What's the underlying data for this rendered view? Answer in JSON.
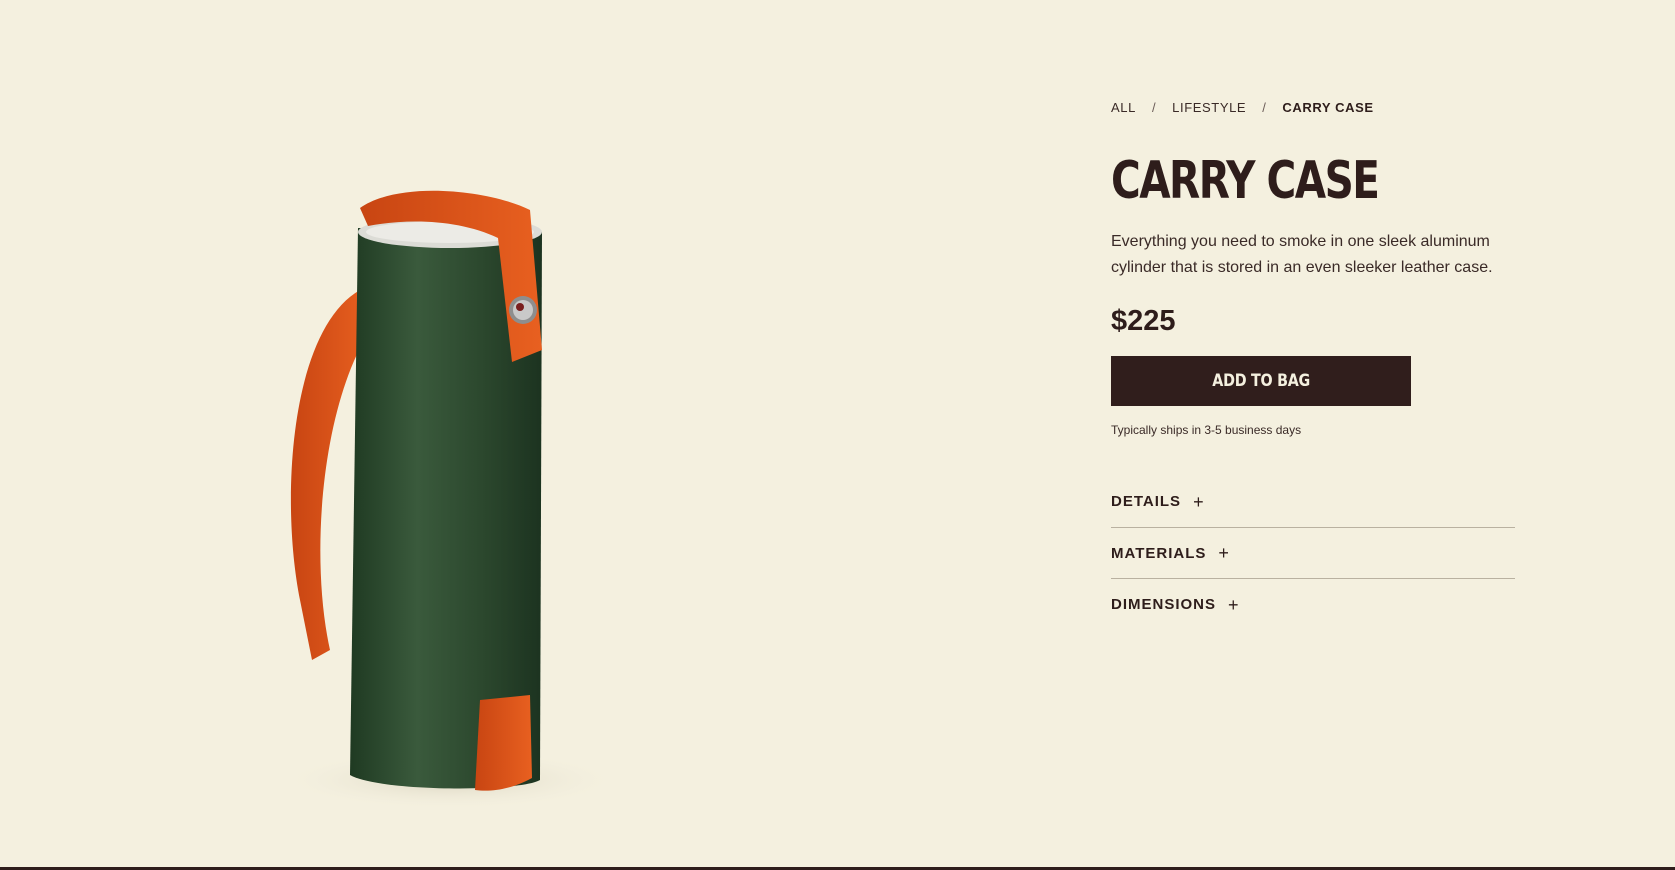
{
  "breadcrumb": {
    "items": [
      "ALL",
      "LIFESTYLE",
      "CARRY CASE"
    ],
    "separator": "/"
  },
  "product": {
    "title": "CARRY CASE",
    "description": "Everything you need to smoke in one sleek aluminum cylinder that is stored in an even sleeker leather case.",
    "price": "$225",
    "add_to_bag_label": "ADD TO BAG",
    "shipping_note": "Typically ships in 3-5 business days"
  },
  "accordion": {
    "sections": [
      {
        "label": "DETAILS",
        "icon": "+"
      },
      {
        "label": "MATERIALS",
        "icon": "+"
      },
      {
        "label": "DIMENSIONS",
        "icon": "+"
      }
    ]
  },
  "colors": {
    "background": "#f4f0df",
    "text": "#2e1d1b",
    "button": "#301e1c",
    "case_green": "#2d4a2e",
    "strap_orange": "#e0571a"
  }
}
